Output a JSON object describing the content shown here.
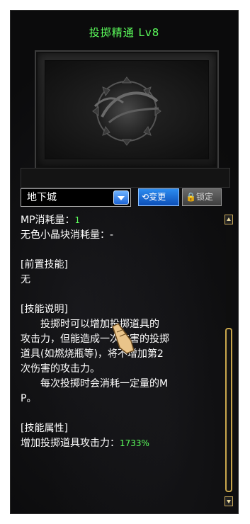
{
  "skill": {
    "name_level": "投掷精通 Lv8"
  },
  "icon": {
    "name": "skill-emblem-icon"
  },
  "controls": {
    "dungeon_select": "地下城",
    "change_button": "变更",
    "lock_button": "锁定"
  },
  "details": {
    "mp_cost_label": "MP消耗量：",
    "mp_cost_value": "1",
    "crystal_cost": "无色小晶块消耗量：-",
    "prereq_header": "[前置技能]",
    "prereq_value": "无",
    "desc_header": "[技能说明]",
    "desc_line1": "投掷时可以增加投掷道具的",
    "desc_line2": "攻击力，但能造成一次伤害的投掷",
    "desc_line3": "道具(如燃烧瓶等)，将不增加第2",
    "desc_line4": "次伤害的攻击力。",
    "desc_line5": "每次投掷时会消耗一定量的M",
    "desc_line6": "P。",
    "attr_header": "[技能属性]",
    "attr_label": "增加投掷道具攻击力：",
    "attr_value": "1733%"
  },
  "colors": {
    "title_green": "#5cff5c",
    "panel_bg": "#0b0b0c",
    "button_blue": "#1f66d6",
    "scrollbar_gold": "#c9a64c"
  }
}
